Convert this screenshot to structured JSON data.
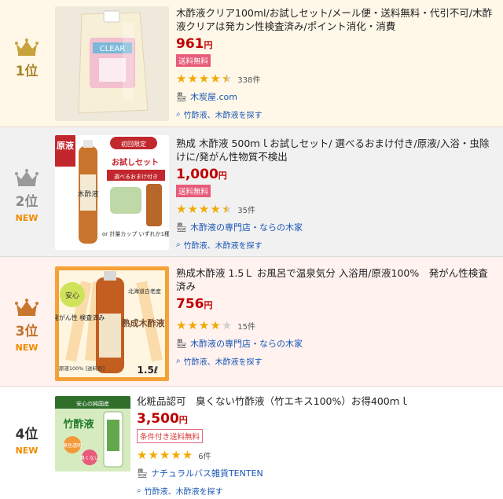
{
  "items": [
    {
      "rank": "1位",
      "badge": "",
      "title": "木酢液クリア100ml/お試しセット/メール便・送料無料・代引不可/木酢液クリアは発カン性検査済み/ポイント消化・消費",
      "price": "961",
      "yen": "円",
      "shipping": "送料無料",
      "rating": 4.5,
      "review_count": "338件",
      "shop": "木炭屋.com",
      "search_link": "竹酢液、木酢液を探す",
      "image_text": "CLEAR",
      "crown_color": "#c8a23a"
    },
    {
      "rank": "2位",
      "badge": "NEW",
      "title": "熟成 木酢液 500ｍｌお試しセット/ 選べるおまけ付き/原液/入浴・虫除けに/発がん性物質不検出",
      "price": "1,000",
      "yen": "円",
      "shipping": "送料無料",
      "rating": 4.5,
      "review_count": "35件",
      "shop": "木酢液の専門店・ならの木家",
      "search_link": "竹酢液、木酢液を探す",
      "image_text": {
        "label1": "原液",
        "label2": "初回限定",
        "label3": "お試しセット",
        "label4": "選べるおまけ付き",
        "label5": "木酢液",
        "label6": "or 計量カップ いずれか1種"
      },
      "crown_color": "#9a9a9a"
    },
    {
      "rank": "3位",
      "badge": "NEW",
      "title": "熟成木酢液 1.5Ｌ お風呂で温泉気分 入浴用/原液100%　発がん性検査済み",
      "price": "756",
      "yen": "円",
      "shipping": "",
      "rating": 4.0,
      "review_count": "15件",
      "shop": "木酢液の専門店・ならの木家",
      "search_link": "竹酢液、木酢液を探す",
      "image_text": {
        "label1": "安心",
        "label2": "発がん性 検査済み",
        "label3": "北海道白老産",
        "label4": "熟成木酢液",
        "label5": "1.5ℓ",
        "label6": "原液100% [送料別]"
      },
      "crown_color": "#c8782e"
    },
    {
      "rank": "4位",
      "badge": "NEW",
      "title": "化粧品認可　臭くない竹酢液（竹エキス100%）お得400ｍｌ",
      "price": "3,500",
      "yen": "円",
      "shipping": "条件付き送料無料",
      "rating": 5.0,
      "review_count": "6件",
      "shop": "ナチュラルバス雑貨TENTEN",
      "search_link": "竹酢液、木酢液を探す",
      "image_text": {
        "label1": "安心の純国産",
        "label2": "竹酢液",
        "label3": "無色透明",
        "label4": "臭くない"
      },
      "crown_color": ""
    }
  ]
}
